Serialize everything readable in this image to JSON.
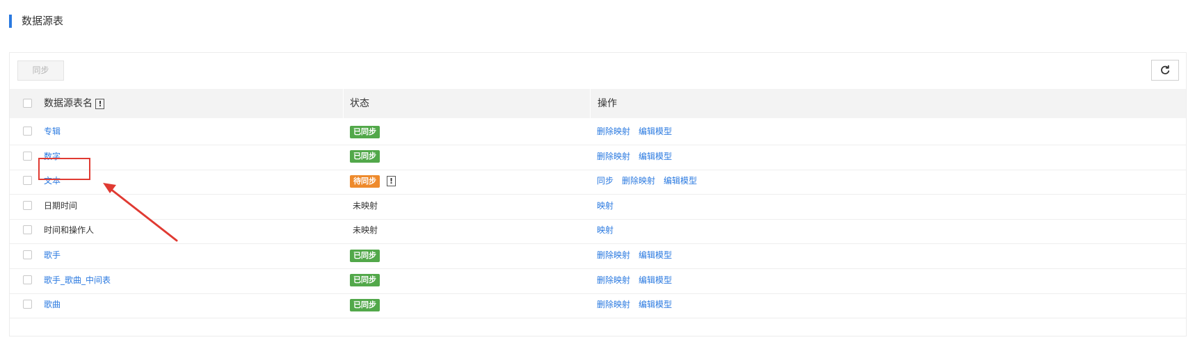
{
  "page": {
    "title": "数据源表"
  },
  "toolbar": {
    "sync_label": "同步"
  },
  "table": {
    "headers": {
      "name": "数据源表名",
      "status": "状态",
      "actions": "操作"
    },
    "info_mark": "!",
    "rows": [
      {
        "name": "专辑",
        "name_is_link": true,
        "status": "已同步",
        "status_type": "synced",
        "actions": [
          "删除映射",
          "编辑模型"
        ]
      },
      {
        "name": "数字",
        "name_is_link": true,
        "status": "已同步",
        "status_type": "synced",
        "actions": [
          "删除映射",
          "编辑模型"
        ]
      },
      {
        "name": "文本",
        "name_is_link": true,
        "status": "待同步",
        "status_type": "pending",
        "status_info": "!",
        "actions": [
          "同步",
          "删除映射",
          "编辑模型"
        ]
      },
      {
        "name": "日期时间",
        "name_is_link": false,
        "status": "未映射",
        "status_type": "unmapped",
        "actions": [
          "映射"
        ]
      },
      {
        "name": "时间和操作人",
        "name_is_link": false,
        "status": "未映射",
        "status_type": "unmapped",
        "actions": [
          "映射"
        ]
      },
      {
        "name": "歌手",
        "name_is_link": true,
        "status": "已同步",
        "status_type": "synced",
        "actions": [
          "删除映射",
          "编辑模型"
        ]
      },
      {
        "name": "歌手_歌曲_中间表",
        "name_is_link": true,
        "status": "已同步",
        "status_type": "synced",
        "actions": [
          "删除映射",
          "编辑模型"
        ]
      },
      {
        "name": "歌曲",
        "name_is_link": true,
        "status": "已同步",
        "status_type": "synced",
        "actions": [
          "删除映射",
          "编辑模型"
        ]
      }
    ]
  },
  "colors": {
    "accent": "#2b7ae0",
    "synced": "#52a84a",
    "pending": "#ee8a2c",
    "annotation": "#e03a32"
  },
  "icons": {
    "refresh": "refresh-icon"
  }
}
